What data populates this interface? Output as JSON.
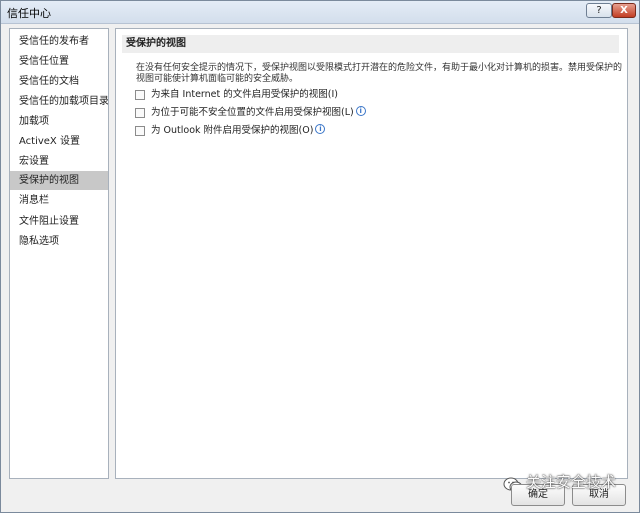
{
  "window": {
    "title": "信任中心",
    "help_label": "?",
    "close_label": "X"
  },
  "sidebar": {
    "items": [
      {
        "label": "受信任的发布者",
        "selected": false
      },
      {
        "label": "受信任位置",
        "selected": false
      },
      {
        "label": "受信任的文档",
        "selected": false
      },
      {
        "label": "受信任的加载项目录",
        "selected": false
      },
      {
        "label": "加载项",
        "selected": false
      },
      {
        "label": "ActiveX 设置",
        "selected": false
      },
      {
        "label": "宏设置",
        "selected": false
      },
      {
        "label": "受保护的视图",
        "selected": true
      },
      {
        "label": "消息栏",
        "selected": false
      },
      {
        "label": "文件阻止设置",
        "selected": false
      },
      {
        "label": "隐私选项",
        "selected": false
      }
    ]
  },
  "main": {
    "section_title": "受保护的视图",
    "description": "在没有任何安全提示的情况下，受保护视图以受限模式打开潜在的危险文件，有助于最小化对计算机的损害。禁用受保护的视图可能使计算机面临可能的安全威胁。",
    "options": [
      {
        "label": "为来自 Internet 的文件启用受保护的视图(I)",
        "checked": false,
        "info": false
      },
      {
        "label": "为位于可能不安全位置的文件启用受保护视图(L)",
        "checked": false,
        "info": true
      },
      {
        "label": "为 Outlook 附件启用受保护的视图(O)",
        "checked": false,
        "info": true
      }
    ]
  },
  "footer": {
    "ok_label": "确定",
    "cancel_label": "取消"
  },
  "watermark": {
    "text": "关注安全技术"
  }
}
